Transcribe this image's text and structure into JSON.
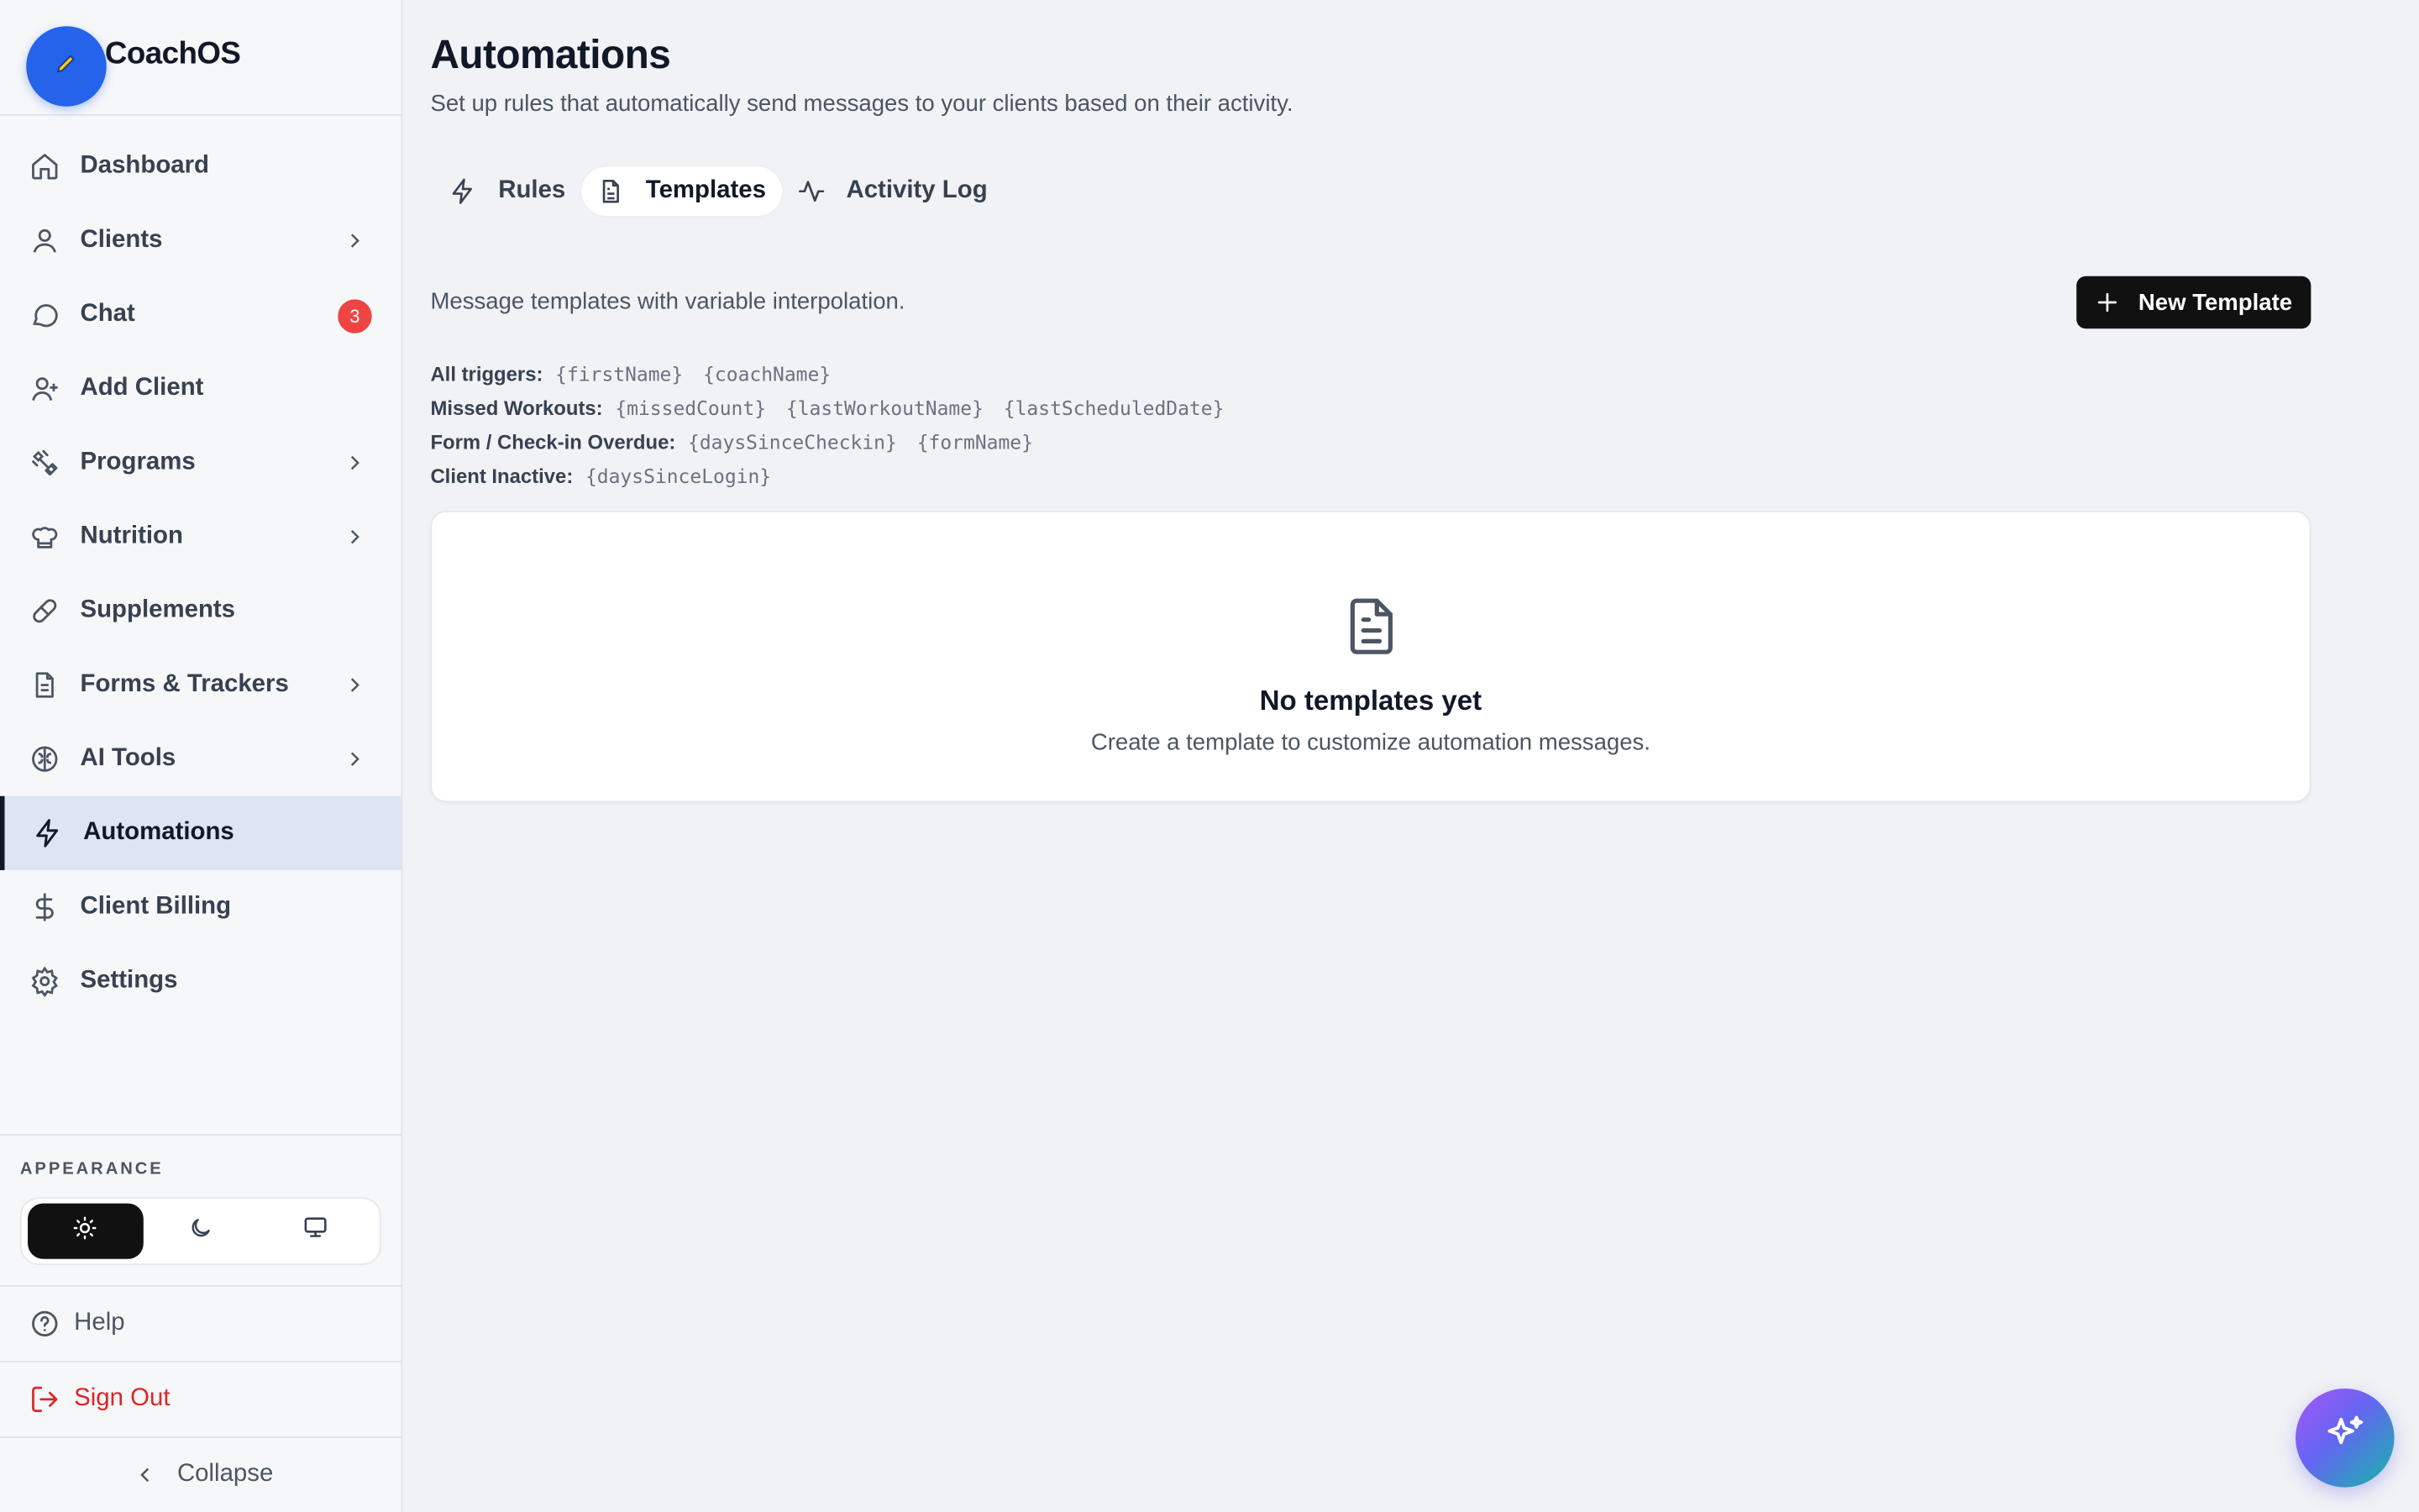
{
  "brand": {
    "name": "CoachOS",
    "logo_icon": "pencil-icon",
    "accent": "#2563eb"
  },
  "sidebar": {
    "items": [
      {
        "label": "Dashboard",
        "icon": "home-icon"
      },
      {
        "label": "Clients",
        "icon": "user-icon",
        "has_children": true
      },
      {
        "label": "Chat",
        "icon": "message-icon",
        "badge": "3"
      },
      {
        "label": "Add Client",
        "icon": "user-plus-icon"
      },
      {
        "label": "Programs",
        "icon": "dumbbell-icon",
        "has_children": true
      },
      {
        "label": "Nutrition",
        "icon": "chef-hat-icon",
        "has_children": true
      },
      {
        "label": "Supplements",
        "icon": "pill-icon"
      },
      {
        "label": "Forms & Trackers",
        "icon": "file-icon",
        "has_children": true
      },
      {
        "label": "AI Tools",
        "icon": "brain-icon",
        "has_children": true
      },
      {
        "label": "Automations",
        "icon": "zap-icon",
        "active": true
      },
      {
        "label": "Client Billing",
        "icon": "dollar-icon"
      },
      {
        "label": "Settings",
        "icon": "gear-icon"
      }
    ],
    "appearance": {
      "label": "APPEARANCE",
      "options": [
        "light",
        "dark",
        "system"
      ],
      "selected": "light"
    },
    "help_label": "Help",
    "signout_label": "Sign Out",
    "collapse_label": "Collapse"
  },
  "main": {
    "title": "Automations",
    "subtitle": "Set up rules that automatically send messages to your clients based on their activity.",
    "tabs": [
      {
        "label": "Rules",
        "icon": "zap-icon"
      },
      {
        "label": "Templates",
        "icon": "file-text-icon",
        "active": true
      },
      {
        "label": "Activity Log",
        "icon": "activity-icon"
      }
    ],
    "description": "Message templates with variable interpolation.",
    "new_button_label": "New Template",
    "variables": [
      {
        "label": "All triggers:",
        "tokens": [
          "{firstName}",
          "{coachName}"
        ]
      },
      {
        "label": "Missed Workouts:",
        "tokens": [
          "{missedCount}",
          "{lastWorkoutName}",
          "{lastScheduledDate}"
        ]
      },
      {
        "label": "Form / Check-in Overdue:",
        "tokens": [
          "{daysSinceCheckin}",
          "{formName}"
        ]
      },
      {
        "label": "Client Inactive:",
        "tokens": [
          "{daysSinceLogin}"
        ]
      }
    ],
    "empty": {
      "title": "No templates yet",
      "text": "Create a template to customize automation messages."
    }
  },
  "colors": {
    "danger": "#dc2626",
    "badge": "#ef4444",
    "active_bg": "#dde5f4",
    "primary_button": "#111111"
  }
}
